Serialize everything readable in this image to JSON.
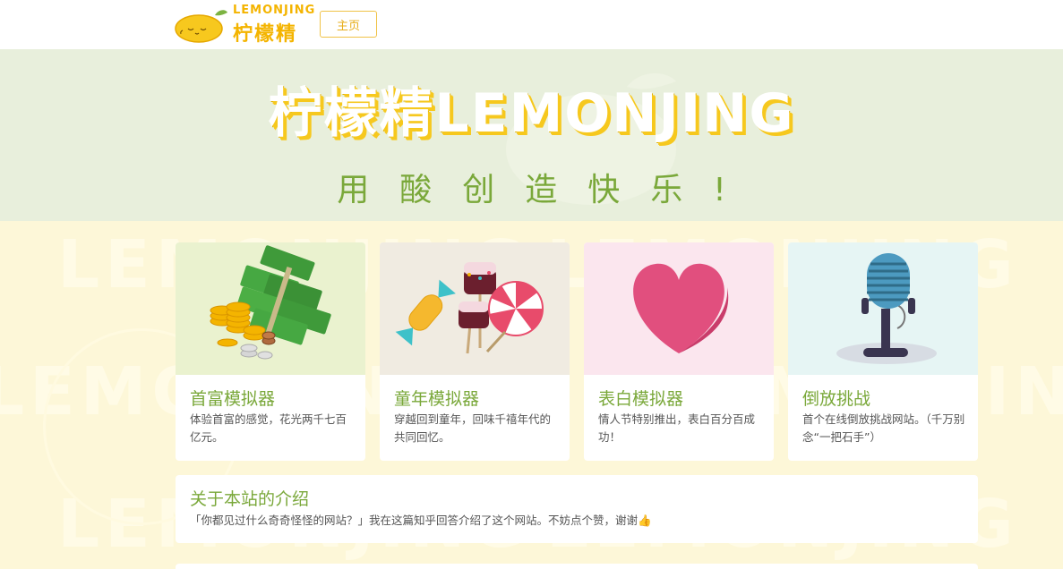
{
  "header": {
    "logo_en": "LEMONJING",
    "logo_zh": "柠檬精",
    "nav_home": "主页"
  },
  "hero": {
    "title": "柠檬精LEMONJING",
    "subtitle": "用酸创造快乐!"
  },
  "watermark": {
    "text": "LEMONJING"
  },
  "cards": [
    {
      "title": "首富模拟器",
      "desc": "体验首富的感觉，花光两千七百亿元。",
      "icon": "money-stack-icon",
      "bg": "#eaf2cf"
    },
    {
      "title": "童年模拟器",
      "desc": "穿越回到童年，回味千禧年代的共同回忆。",
      "icon": "candy-icon",
      "bg": "#f0ebe1"
    },
    {
      "title": "表白模拟器",
      "desc": "情人节特别推出，表白百分百成功！",
      "icon": "heart-icon",
      "bg": "#fbe6ee"
    },
    {
      "title": "倒放挑战",
      "desc": "首个在线倒放挑战网站。（千万别念“一把石手”）",
      "icon": "microphone-icon",
      "bg": "#e6f5f4"
    }
  ],
  "intro": {
    "title": "关于本站的介绍",
    "text": "「你都见过什么奇奇怪怪的网站？」我在这篇知乎回答介绍了这个网站。不妨点个赞，谢谢👍"
  },
  "colors": {
    "brand_yellow": "#f4b400",
    "accent_green": "#7aa83a",
    "hero_bg": "#e8efdc",
    "page_bg": "#fdf7d8"
  }
}
